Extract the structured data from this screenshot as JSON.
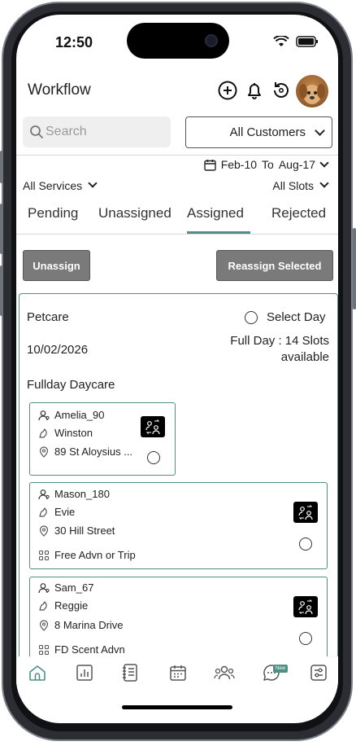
{
  "status": {
    "time": "12:50"
  },
  "header": {
    "title": "Workflow"
  },
  "search": {
    "placeholder": "Search"
  },
  "customer_select": {
    "value": "All Customers"
  },
  "date_range": {
    "from": "Feb-10",
    "to_label": "To",
    "to": "Aug-17"
  },
  "filters": {
    "services": "All Services",
    "slots": "All Slots"
  },
  "tabs": [
    {
      "label": "Pending"
    },
    {
      "label": "Unassigned"
    },
    {
      "label": "Assigned",
      "active": true
    },
    {
      "label": "Rejected"
    }
  ],
  "actions": {
    "unassign": "Unassign",
    "reassign": "Reassign Selected"
  },
  "card": {
    "service": "Petcare",
    "select_day": "Select Day",
    "date": "10/02/2026",
    "availability": "Full Day : 14 Slots available",
    "availability_line1": "Full Day : 14 Slots",
    "availability_line2": "available",
    "service_type": "Fullday Daycare",
    "bookings": [
      {
        "owner": "Amelia_90",
        "pet": "Winston",
        "address": "89 St Aloysius ..."
      },
      {
        "owner": "Mason_180",
        "pet": "Evie",
        "address": "30 Hill Street",
        "package": "Free Advn or Trip"
      },
      {
        "owner": "Sam_67",
        "pet": "Reggie",
        "address": "8 Marina Drive",
        "package": "FD Scent Advn"
      }
    ]
  },
  "nav": {
    "items": [
      "home-icon",
      "reports-icon",
      "bookings-icon",
      "calendar-icon",
      "customers-icon",
      "messages-icon",
      "settings-icon"
    ],
    "new_badge": "New"
  },
  "colors": {
    "accent": "#4f8f85",
    "button_gray": "#7a7a7a"
  }
}
